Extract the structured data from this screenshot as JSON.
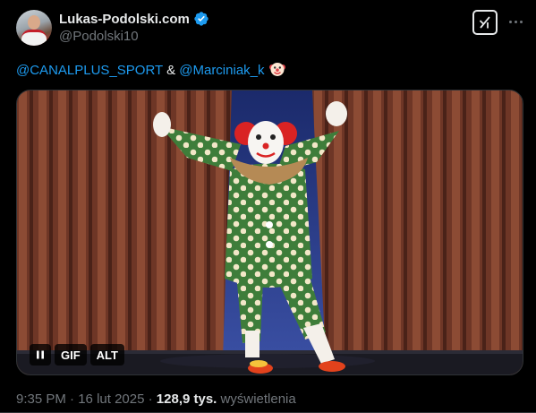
{
  "author": {
    "display_name": "Lukas-Podolski.com",
    "handle": "@Podolski10",
    "verified": true
  },
  "header": {
    "grok_icon": "grok-icon",
    "more_icon": "more-horizontal-icon"
  },
  "tweet": {
    "mention_1": "@CANALPLUS_SPORT",
    "separator": " & ",
    "mention_2": "@Marciniak_k",
    "emoji": "clown-face-emoji"
  },
  "media": {
    "description": "clown-dancing-on-stage-gif",
    "pause_icon": "pause-icon",
    "gif_label": "GIF",
    "alt_label": "ALT"
  },
  "meta": {
    "time": "9:35 PM",
    "dot_1": " · ",
    "date": "16 lut 2025",
    "dot_2": " · ",
    "views_count": "128,9 tys.",
    "views_label": " wyświetlenia"
  },
  "colors": {
    "background": "#000000",
    "text": "#e7e9ea",
    "secondary": "#71767b",
    "link": "#1d9bf0",
    "verified": "#1d9bf0"
  }
}
